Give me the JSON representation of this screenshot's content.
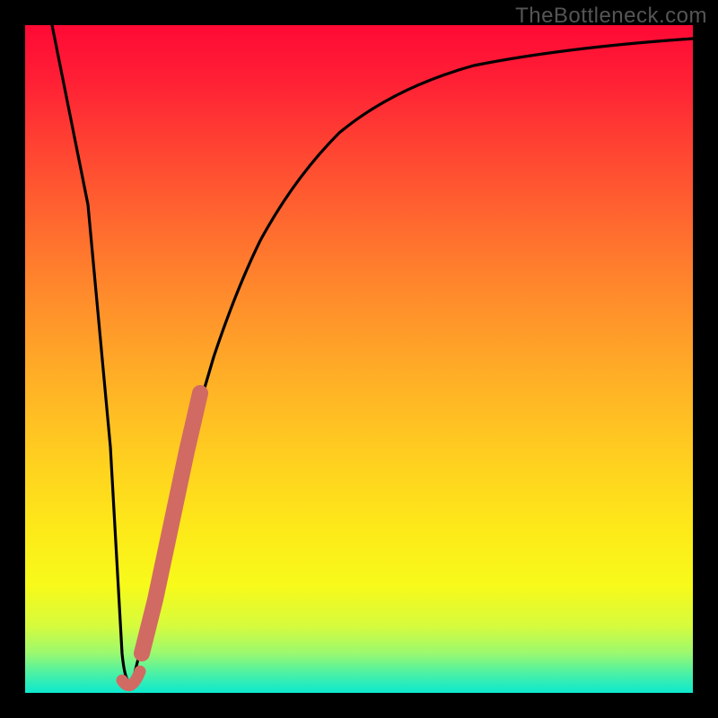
{
  "watermark": "TheBottleneck.com",
  "colors": {
    "frame": "#000000",
    "curve": "#000000",
    "marker": "#d16a63",
    "gradient_top": "#ff0935",
    "gradient_bottom": "#0de8cf"
  },
  "chart_data": {
    "type": "line",
    "title": "",
    "xlabel": "",
    "ylabel": "",
    "xlim": [
      0,
      100
    ],
    "ylim": [
      0,
      100
    ],
    "series": [
      {
        "name": "bottleneck-curve",
        "x": [
          4,
          6,
          8,
          10,
          12,
          13.5,
          14.5,
          16,
          18,
          20,
          22,
          24,
          26,
          28,
          30,
          34,
          38,
          42,
          48,
          55,
          62,
          70,
          78,
          86,
          94,
          100
        ],
        "y": [
          100,
          85,
          70,
          55,
          35,
          10,
          2,
          10,
          25,
          38,
          50,
          59,
          66,
          72,
          77,
          83,
          87,
          90,
          92.5,
          94.5,
          95.8,
          96.7,
          97.3,
          97.8,
          98.2,
          98.5
        ]
      }
    ],
    "highlight_segment": {
      "name": "marker-band",
      "x": [
        16.5,
        17.5,
        18.5,
        19.5,
        20.5,
        21.5,
        22.5,
        23.5,
        24.5
      ],
      "y": [
        5,
        12,
        20,
        28,
        36,
        43,
        49,
        54,
        58
      ]
    },
    "minimum": {
      "x": 14.5,
      "y": 2
    }
  }
}
